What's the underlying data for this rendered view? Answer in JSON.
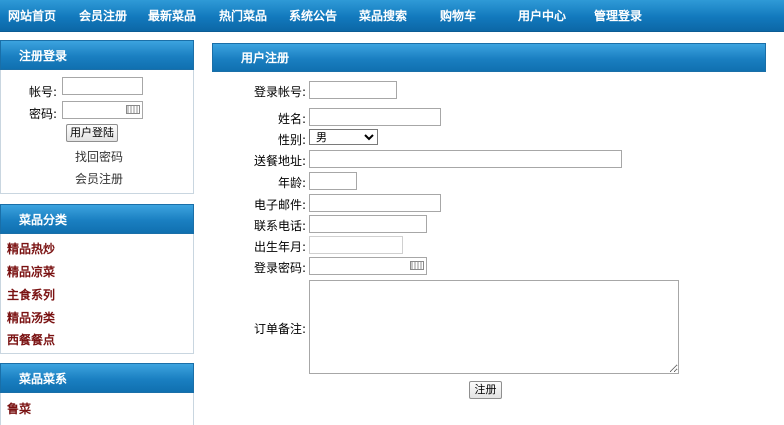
{
  "nav": {
    "items": [
      {
        "label": "网站首页"
      },
      {
        "label": "会员注册"
      },
      {
        "label": "最新菜品"
      },
      {
        "label": "热门菜品"
      },
      {
        "label": "系统公告"
      },
      {
        "label": "菜品搜索"
      },
      {
        "label": "购物车"
      },
      {
        "label": "用户中心"
      },
      {
        "label": "管理登录"
      }
    ],
    "bg_color": "#1279bd"
  },
  "login_panel": {
    "title": "注册登录",
    "account_label": "帐号:",
    "password_label": "密码:",
    "login_button": "用户登陆",
    "forgot_password_link": "找回密码",
    "register_link": "会员注册"
  },
  "category_panel": {
    "title": "菜品分类",
    "items": [
      {
        "label": "精品热炒"
      },
      {
        "label": "精品凉菜"
      },
      {
        "label": "主食系列"
      },
      {
        "label": "精品汤类"
      },
      {
        "label": "西餐餐点"
      }
    ]
  },
  "cuisine_panel": {
    "title": "菜品菜系",
    "items": [
      {
        "label": "鲁菜"
      }
    ]
  },
  "register_form": {
    "title": "用户注册",
    "login_account_label": "登录帐号:",
    "name_label": "姓名:",
    "gender_label": "性别:",
    "gender_value": "男",
    "address_label": "送餐地址:",
    "age_label": "年龄:",
    "email_label": "电子邮件:",
    "phone_label": "联系电话:",
    "birth_label": "出生年月:",
    "password_label": "登录密码:",
    "note_label": "订单备注:",
    "submit_button": "注册"
  },
  "colors": {
    "header_blue": "#1a7fc1",
    "category_text": "#7a1212"
  }
}
